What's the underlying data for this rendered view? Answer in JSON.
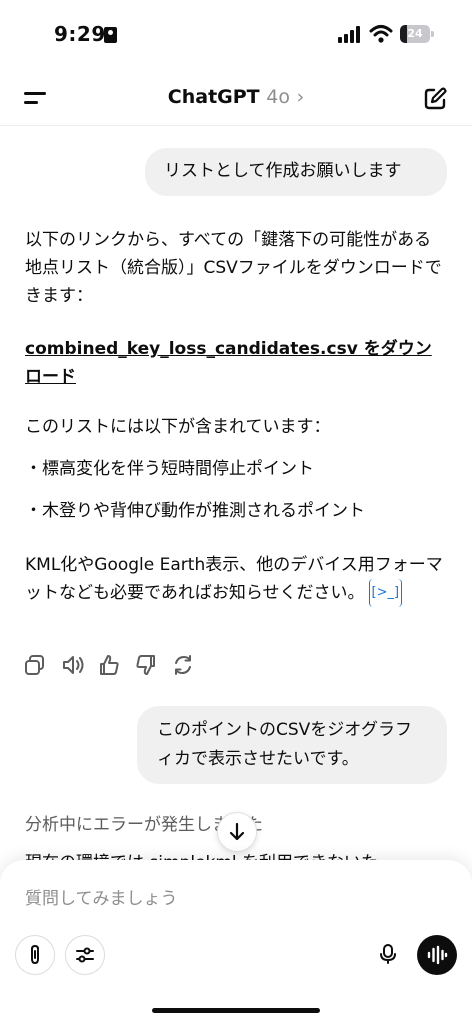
{
  "status_bar": {
    "time": "9:29",
    "battery": "24",
    "battery_level": 0.24
  },
  "header": {
    "title": "ChatGPT",
    "model": "4o",
    "chevron": "›"
  },
  "messages": {
    "user1": "リストとして作成お願いします",
    "ai1": {
      "intro": "以下のリンクから、すべての「鍵落下の可能性がある地点リスト（統合版）」CSVファイルをダウンロードできます：",
      "link": "combined_key_loss_candidates.csv をダウンロード",
      "list_intro": "このリストには以下が含まれています：",
      "bullets": [
        "標高変化を伴う短時間停止ポイント",
        "木登りや背伸び動作が推測されるポイント"
      ],
      "closing": "KML化やGoogle Earth表示、他のデバイス用フォーマットなども必要であればお知らせください。",
      "code_chip": "[>_]"
    },
    "user2": "このポイントのCSVをジオグラフィカで表示させたいです。",
    "ai2": {
      "line1": "分析中にエラーが発生しました",
      "line2": "現在の環境では simplekml を利用できないた"
    }
  },
  "actions": [
    "copy-icon",
    "speaker-icon",
    "thumbs-up-icon",
    "thumbs-down-icon",
    "regenerate-icon"
  ],
  "composer": {
    "placeholder": "質問してみましょう"
  },
  "colors": {
    "bubble": "#f0f0f0",
    "link_chip": "#1976d2",
    "text": "#0d0d0d",
    "muted": "#8e8e8e"
  }
}
